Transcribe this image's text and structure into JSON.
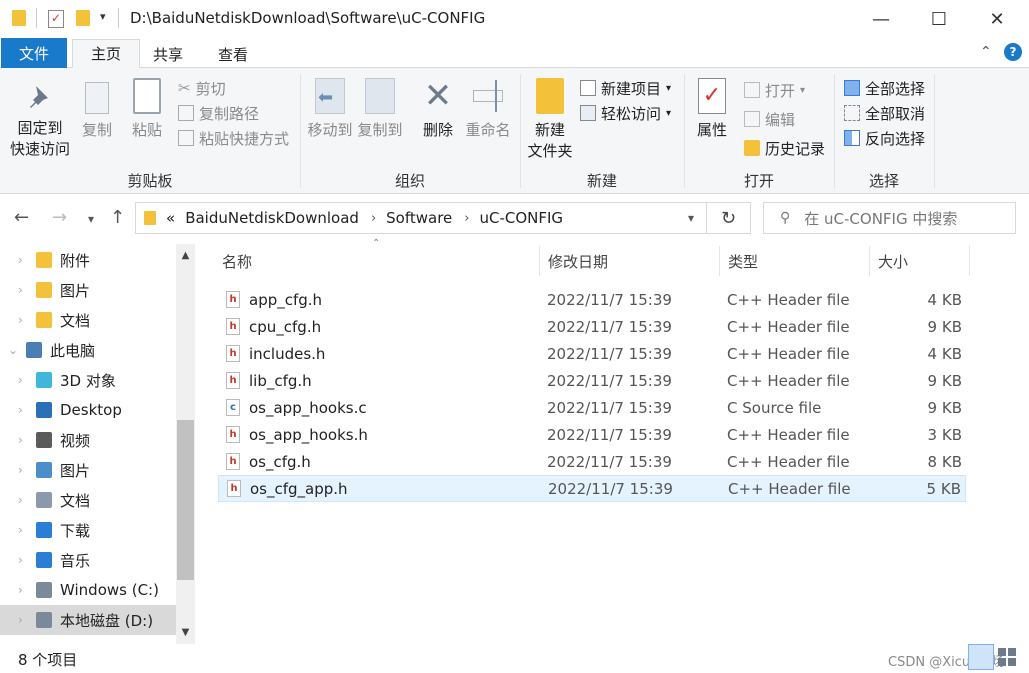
{
  "window": {
    "title": "D:\\BaiduNetdiskDownload\\Software\\uC-CONFIG",
    "minimize": "—",
    "maximize": "☐",
    "close": "✕"
  },
  "tabs": {
    "file": "文件",
    "home": "主页",
    "share": "共享",
    "view": "查看"
  },
  "ribbon": {
    "clipboard": {
      "label": "剪贴板",
      "pin": [
        "固定到",
        "快速访问"
      ],
      "copy": "复制",
      "paste": "粘贴",
      "cut": "剪切",
      "copy_path": "复制路径",
      "paste_shortcut": "粘贴快捷方式"
    },
    "organize": {
      "label": "组织",
      "move_to": "移动到",
      "copy_to": "复制到",
      "delete": "删除",
      "rename": "重命名"
    },
    "new": {
      "label": "新建",
      "new_folder": [
        "新建",
        "文件夹"
      ],
      "new_item": "新建项目",
      "easy_access": "轻松访问"
    },
    "open": {
      "label": "打开",
      "properties": "属性",
      "open": "打开",
      "edit": "编辑",
      "history": "历史记录"
    },
    "select": {
      "label": "选择",
      "select_all": "全部选择",
      "select_none": "全部取消",
      "invert": "反向选择"
    }
  },
  "address": {
    "prefix": "«",
    "crumbs": [
      "BaiduNetdiskDownload",
      "Software",
      "uC-CONFIG"
    ],
    "search_placeholder": "在 uC-CONFIG 中搜索"
  },
  "nav": [
    {
      "label": "附件",
      "icon": "folder-icon",
      "indent": 1
    },
    {
      "label": "图片",
      "icon": "folder-icon",
      "indent": 1
    },
    {
      "label": "文档",
      "icon": "folder-icon",
      "indent": 1
    },
    {
      "label": "此电脑",
      "icon": "pc-icon",
      "indent": 0
    },
    {
      "label": "3D 对象",
      "icon": "3d-objects-icon",
      "indent": 1
    },
    {
      "label": "Desktop",
      "icon": "desktop-icon",
      "indent": 1
    },
    {
      "label": "视频",
      "icon": "videos-icon",
      "indent": 1
    },
    {
      "label": "图片",
      "icon": "pictures-icon",
      "indent": 1
    },
    {
      "label": "文档",
      "icon": "documents-icon",
      "indent": 1
    },
    {
      "label": "下载",
      "icon": "downloads-icon",
      "indent": 1
    },
    {
      "label": "音乐",
      "icon": "music-icon",
      "indent": 1
    },
    {
      "label": "Windows (C:)",
      "icon": "drive-icon",
      "indent": 1
    },
    {
      "label": "本地磁盘 (D:)",
      "icon": "drive-icon",
      "indent": 1
    }
  ],
  "columns": {
    "name": "名称",
    "modified": "修改日期",
    "type": "类型",
    "size": "大小"
  },
  "files": [
    {
      "name": "app_cfg.h",
      "date": "2022/11/7 15:39",
      "type": "C++ Header file",
      "size": "4 KB",
      "kind": "h"
    },
    {
      "name": "cpu_cfg.h",
      "date": "2022/11/7 15:39",
      "type": "C++ Header file",
      "size": "9 KB",
      "kind": "h"
    },
    {
      "name": "includes.h",
      "date": "2022/11/7 15:39",
      "type": "C++ Header file",
      "size": "4 KB",
      "kind": "h"
    },
    {
      "name": "lib_cfg.h",
      "date": "2022/11/7 15:39",
      "type": "C++ Header file",
      "size": "9 KB",
      "kind": "h"
    },
    {
      "name": "os_app_hooks.c",
      "date": "2022/11/7 15:39",
      "type": "C Source file",
      "size": "9 KB",
      "kind": "c"
    },
    {
      "name": "os_app_hooks.h",
      "date": "2022/11/7 15:39",
      "type": "C++ Header file",
      "size": "3 KB",
      "kind": "h"
    },
    {
      "name": "os_cfg.h",
      "date": "2022/11/7 15:39",
      "type": "C++ Header file",
      "size": "8 KB",
      "kind": "h"
    },
    {
      "name": "os_cfg_app.h",
      "date": "2022/11/7 15:39",
      "type": "C++ Header file",
      "size": "5 KB",
      "kind": "h"
    }
  ],
  "status": {
    "count": "8 个项目",
    "watermark": "CSDN @Xicun玖炀"
  },
  "colors": {
    "accent": "#1979ca",
    "selection": "#e5f3ff",
    "folder": "#f4c13a"
  }
}
